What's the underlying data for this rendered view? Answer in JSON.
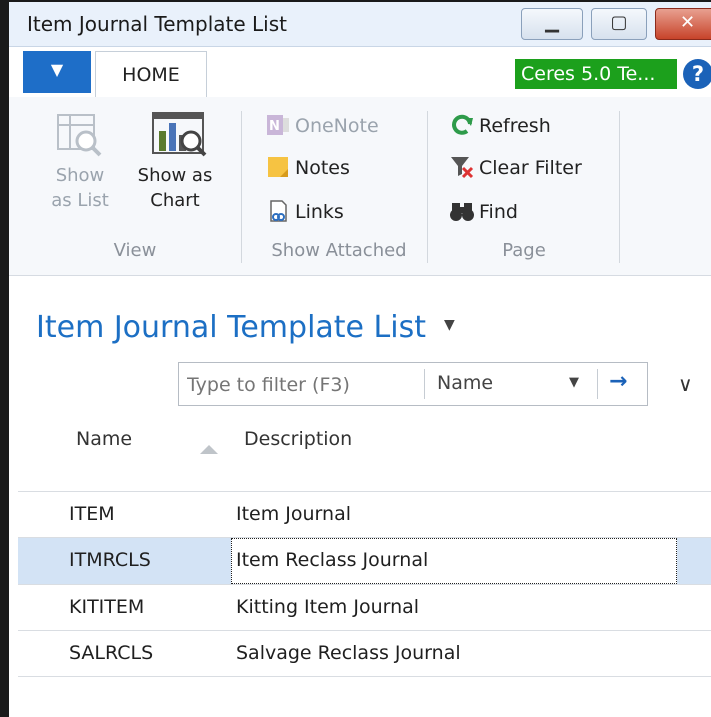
{
  "window": {
    "title": "Item Journal Template List"
  },
  "ribbon": {
    "home_tab": "HOME",
    "company": "Ceres 5.0 Te...",
    "help": "?",
    "view": {
      "group": "View",
      "show_as_list_1": "Show",
      "show_as_list_2": "as List",
      "show_as_chart_1": "Show as",
      "show_as_chart_2": "Chart"
    },
    "show_attached": {
      "group": "Show Attached",
      "onenote": "OneNote",
      "notes": "Notes",
      "links": "Links"
    },
    "page": {
      "group": "Page",
      "refresh": "Refresh",
      "clear_filter": "Clear Filter",
      "find": "Find"
    }
  },
  "list": {
    "title": "Item Journal Template List",
    "filter_placeholder": "Type to filter (F3)",
    "filter_field": "Name",
    "columns": {
      "name": "Name",
      "description": "Description"
    },
    "rows": [
      {
        "name": "ITEM",
        "description": "Item Journal"
      },
      {
        "name": "ITMRCLS",
        "description": "Item Reclass Journal"
      },
      {
        "name": "KITITEM",
        "description": "Kitting Item Journal"
      },
      {
        "name": "SALRCLS",
        "description": "Salvage Reclass Journal"
      }
    ],
    "selected_row": 1
  },
  "colors": {
    "accent": "#1c6fc4",
    "company_badge": "#1ca01c",
    "selection": "#d3e3f5"
  }
}
